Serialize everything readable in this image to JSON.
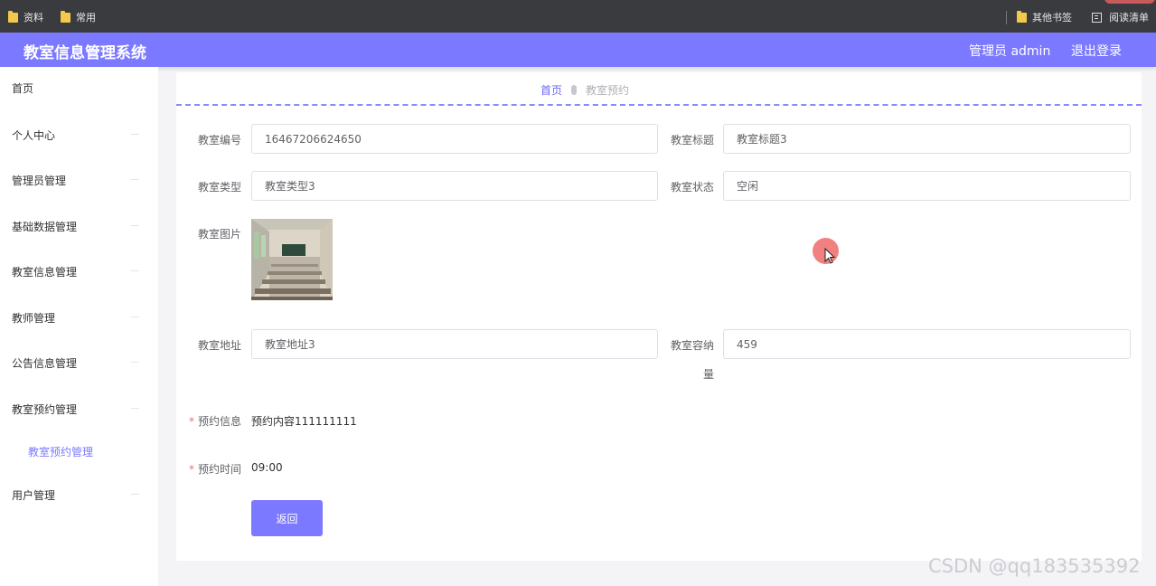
{
  "bookmarks": {
    "left": [
      {
        "label": "资料"
      },
      {
        "label": "常用"
      }
    ],
    "other_label": "其他书签",
    "reading_list_label": "阅读清单"
  },
  "header": {
    "title": "教室信息管理系统",
    "admin_label": "管理员 admin",
    "logout_label": "退出登录"
  },
  "sidebar": {
    "items": [
      {
        "label": "首页"
      },
      {
        "label": "个人中心"
      },
      {
        "label": "管理员管理"
      },
      {
        "label": "基础数据管理"
      },
      {
        "label": "教室信息管理"
      },
      {
        "label": "教师管理"
      },
      {
        "label": "公告信息管理"
      },
      {
        "label": "教室预约管理"
      },
      {
        "label": "教室预约管理"
      },
      {
        "label": "用户管理"
      }
    ]
  },
  "breadcrumb": {
    "home": "首页",
    "current": "教室预约"
  },
  "form": {
    "classroom_no": {
      "label": "教室编号",
      "value": "16467206624650"
    },
    "classroom_title": {
      "label": "教室标题",
      "value": "教室标题3"
    },
    "classroom_type": {
      "label": "教室类型",
      "value": "教室类型3"
    },
    "classroom_status": {
      "label": "教室状态",
      "value": "空闲"
    },
    "classroom_image": {
      "label": "教室图片"
    },
    "classroom_address": {
      "label": "教室地址",
      "value": "教室地址3"
    },
    "classroom_capacity": {
      "label_line1": "教室容纳",
      "label_line2": "量",
      "value": "459"
    },
    "booking_info": {
      "required_mark": "*",
      "label": "预约信息",
      "value": "预约内容111111111"
    },
    "booking_time": {
      "required_mark": "*",
      "label": "预约时间",
      "value": "09:00"
    },
    "back_button": "返回"
  },
  "watermark": "CSDN @qq183535392",
  "colors": {
    "primary": "#7b79ff",
    "required": "#f56c6c",
    "cursor_highlight": "#ee6060"
  },
  "icons": {
    "bookmark_folder": "folder-icon",
    "reading_list": "reading-list-icon",
    "breadcrumb_separator": "separator-icon",
    "cursor": "mouse-cursor-icon"
  }
}
